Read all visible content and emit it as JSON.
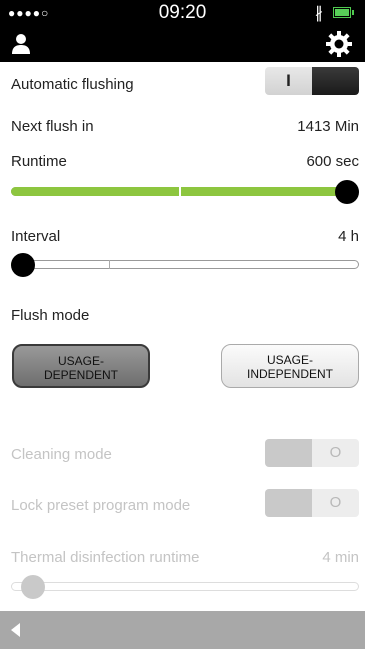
{
  "status_bar": {
    "signal": "●●●●○",
    "time": "09:20",
    "bluetooth": "∦"
  },
  "settings": {
    "automatic_flushing": {
      "label": "Automatic flushing",
      "toggle_mark": "I",
      "state": "on"
    },
    "next_flush": {
      "label": "Next flush in",
      "value": "1413 Min"
    },
    "runtime": {
      "label": "Runtime",
      "value": "600 sec",
      "level": 1.0
    },
    "interval": {
      "label": "Interval",
      "value": "4 h",
      "level": 0.0
    },
    "flush_mode": {
      "label": "Flush mode",
      "options": [
        {
          "line1": "USAGE-",
          "line2": "DEPENDENT",
          "selected": true
        },
        {
          "line1": "USAGE-",
          "line2": "INDEPENDENT",
          "selected": false
        }
      ]
    },
    "cleaning_mode": {
      "label": "Cleaning mode",
      "toggle_mark": "O",
      "state": "off",
      "disabled": true
    },
    "lock_preset": {
      "label": "Lock preset program mode",
      "toggle_mark": "O",
      "state": "off",
      "disabled": true
    },
    "thermal_disinfection": {
      "label": "Thermal disinfection runtime",
      "value": "4 min",
      "level": 0.03,
      "disabled": true
    }
  },
  "colors": {
    "accent_green": "#8dc63f",
    "topbar": "#000000",
    "bottombar": "#a8a8a8"
  },
  "icons": {
    "user": "user-icon",
    "settings": "gear-icon",
    "back": "back-arrow-icon"
  }
}
